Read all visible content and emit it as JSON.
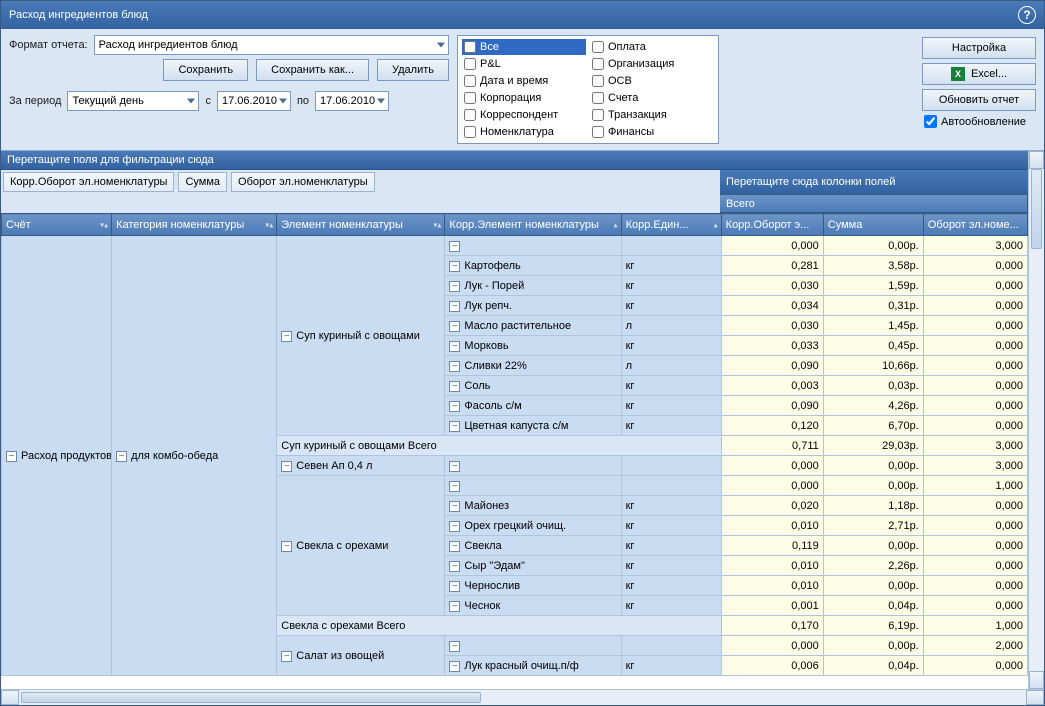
{
  "title": "Расход ингредиентов блюд",
  "toolbar": {
    "format_label": "Формат отчета:",
    "format_value": "Расход ингредиентов блюд",
    "save": "Сохранить",
    "save_as": "Сохранить как...",
    "delete": "Удалить",
    "period_label": "За период",
    "period_value": "Текущий день",
    "from_label": "с",
    "to_label": "по",
    "date_from": "17.06.2010",
    "date_to": "17.06.2010"
  },
  "checks": {
    "c0": "Все",
    "c1": "P&L",
    "c2": "Дата и время",
    "c3": "Корпорация",
    "c4": "Корреспондент",
    "c5": "Номенклатура",
    "c6": "Оплата",
    "c7": "Организация",
    "c8": "ОСВ",
    "c9": "Счета",
    "c10": "Транзакция",
    "c11": "Финансы"
  },
  "right": {
    "settings": "Настройка",
    "excel": "Excel...",
    "refresh": "Обновить отчет",
    "auto": "Автообновление"
  },
  "grid": {
    "filter_drop": "Перетащите поля для фильтрации сюда",
    "col_drop": "Перетащите сюда колонки полей",
    "total_label": "Всего",
    "fields": {
      "f0": "Корр.Оборот эл.номенклатуры",
      "f1": "Сумма",
      "f2": "Оборот эл.номенклатуры"
    },
    "headers": {
      "h0": "Счёт",
      "h1": "Категория номенклатуры",
      "h2": "Элемент номенклатуры",
      "h3": "Корр.Элемент номенклатуры",
      "h4": "Корр.Един...",
      "h5": "Корр.Оборот э...",
      "h6": "Сумма",
      "h7": "Оборот эл.номе..."
    },
    "acct": "Расход продуктов",
    "cat": "для комбо-обеда",
    "elem1": "Суп куриный с овощами",
    "elem2": "Севен Ап 0,4 л",
    "elem3": "Свекла с орехами",
    "elem4": "Салат из овощей",
    "sub1": "Суп куриный с овощами Всего",
    "sub2": "Свекла с орехами Всего",
    "rows": [
      {
        "n": "",
        "u": "",
        "v1": "0,000",
        "v2": "0,00р.",
        "v3": "3,000"
      },
      {
        "n": "Картофель",
        "u": "кг",
        "v1": "0,281",
        "v2": "3,58р.",
        "v3": "0,000"
      },
      {
        "n": "Лук - Порей",
        "u": "кг",
        "v1": "0,030",
        "v2": "1,59р.",
        "v3": "0,000"
      },
      {
        "n": "Лук репч.",
        "u": "кг",
        "v1": "0,034",
        "v2": "0,31р.",
        "v3": "0,000"
      },
      {
        "n": "Масло растительное",
        "u": "л",
        "v1": "0,030",
        "v2": "1,45р.",
        "v3": "0,000"
      },
      {
        "n": "Морковь",
        "u": "кг",
        "v1": "0,033",
        "v2": "0,45р.",
        "v3": "0,000"
      },
      {
        "n": "Сливки 22%",
        "u": "л",
        "v1": "0,090",
        "v2": "10,66р.",
        "v3": "0,000"
      },
      {
        "n": "Соль",
        "u": "кг",
        "v1": "0,003",
        "v2": "0,03р.",
        "v3": "0,000"
      },
      {
        "n": "Фасоль с/м",
        "u": "кг",
        "v1": "0,090",
        "v2": "4,26р.",
        "v3": "0,000"
      },
      {
        "n": "Цветная капуста с/м",
        "u": "кг",
        "v1": "0,120",
        "v2": "6,70р.",
        "v3": "0,000"
      }
    ],
    "st1": {
      "v1": "0,711",
      "v2": "29,03р.",
      "v3": "3,000"
    },
    "r2": {
      "v1": "0,000",
      "v2": "0,00р.",
      "v3": "3,000"
    },
    "r3head": {
      "v1": "0,000",
      "v2": "0,00р.",
      "v3": "1,000"
    },
    "rows3": [
      {
        "n": "Майонез",
        "u": "кг",
        "v1": "0,020",
        "v2": "1,18р.",
        "v3": "0,000"
      },
      {
        "n": "Орех грецкий  очищ.",
        "u": "кг",
        "v1": "0,010",
        "v2": "2,71р.",
        "v3": "0,000"
      },
      {
        "n": "Свекла",
        "u": "кг",
        "v1": "0,119",
        "v2": "0,00р.",
        "v3": "0,000"
      },
      {
        "n": "Сыр \"Эдам\"",
        "u": "кг",
        "v1": "0,010",
        "v2": "2,26р.",
        "v3": "0,000"
      },
      {
        "n": "Чернослив",
        "u": "кг",
        "v1": "0,010",
        "v2": "0,00р.",
        "v3": "0,000"
      },
      {
        "n": "Чеснок",
        "u": "кг",
        "v1": "0,001",
        "v2": "0,04р.",
        "v3": "0,000"
      }
    ],
    "st2": {
      "v1": "0,170",
      "v2": "6,19р.",
      "v3": "1,000"
    },
    "r4head": {
      "v1": "0,000",
      "v2": "0,00р.",
      "v3": "2,000"
    },
    "rows4": [
      {
        "n": "Лук красный очищ.п/ф",
        "u": "кг",
        "v1": "0,006",
        "v2": "0,04р.",
        "v3": "0,000"
      }
    ]
  }
}
